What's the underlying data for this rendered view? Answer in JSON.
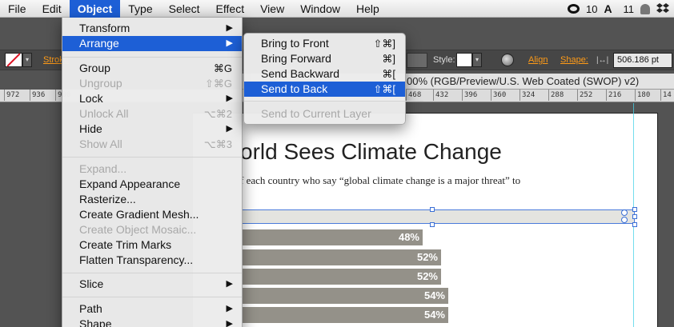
{
  "menubar": {
    "apple_hidden": "",
    "items": [
      "File",
      "Edit",
      "Object",
      "Type",
      "Select",
      "Effect",
      "View",
      "Window",
      "Help"
    ],
    "active": "Object",
    "tray": {
      "cc_count": "10",
      "adobe_count": "11"
    }
  },
  "control_bar": {
    "stroke_label": "Stroke",
    "style_label": "Style:",
    "align_label": "Align",
    "shape_label": "Shape:",
    "width_value": "506.186 pt"
  },
  "document_tab": {
    "title": "00% (RGB/Preview/U.S. Web Coated (SWOP) v2)"
  },
  "ruler": {
    "left_ticks": [
      "972",
      "936",
      "900"
    ],
    "right_ticks": [
      "468",
      "432",
      "396",
      "360",
      "324",
      "288",
      "252",
      "216",
      "180",
      "14"
    ]
  },
  "object_menu": {
    "items": [
      {
        "label": "Transform",
        "submenu": true,
        "disabled": false
      },
      {
        "label": "Arrange",
        "submenu": true,
        "disabled": false,
        "highlighted": true
      },
      {
        "label": "Group",
        "shortcut": "⌘G",
        "disabled": false
      },
      {
        "label": "Ungroup",
        "shortcut": "⇧⌘G",
        "disabled": true
      },
      {
        "label": "Lock",
        "submenu": true,
        "disabled": false
      },
      {
        "label": "Unlock All",
        "shortcut": "⌥⌘2",
        "disabled": true
      },
      {
        "label": "Hide",
        "submenu": true,
        "disabled": false
      },
      {
        "label": "Show All",
        "shortcut": "⌥⌘3",
        "disabled": true
      },
      {
        "label": "Expand...",
        "disabled": true
      },
      {
        "label": "Expand Appearance",
        "disabled": false
      },
      {
        "label": "Rasterize...",
        "disabled": false
      },
      {
        "label": "Create Gradient Mesh...",
        "disabled": false
      },
      {
        "label": "Create Object Mosaic...",
        "disabled": true
      },
      {
        "label": "Create Trim Marks",
        "disabled": false
      },
      {
        "label": "Flatten Transparency...",
        "disabled": false
      },
      {
        "label": "Slice",
        "submenu": true,
        "disabled": false
      },
      {
        "label": "Path",
        "submenu": true,
        "disabled": false
      },
      {
        "label": "Shape",
        "submenu": true,
        "disabled": false
      }
    ]
  },
  "arrange_menu": {
    "items": [
      {
        "label": "Bring to Front",
        "shortcut": "⇧⌘]",
        "disabled": false
      },
      {
        "label": "Bring Forward",
        "shortcut": "⌘]",
        "disabled": false
      },
      {
        "label": "Send Backward",
        "shortcut": "⌘[",
        "disabled": false
      },
      {
        "label": "Send to Back",
        "shortcut": "⇧⌘[",
        "disabled": false,
        "highlighted": true
      },
      {
        "label": "Send to Current Layer",
        "disabled": true
      }
    ]
  },
  "artwork": {
    "title": "orld Sees Climate Change",
    "subtitle": "f each country who say “global climate change is a major threat” to",
    "bars": [
      "48%",
      "52%",
      "52%",
      "54%",
      "54%"
    ]
  },
  "colors": {
    "menu_highlight": "#1d5fd6",
    "bar_fill": "#949189",
    "guide": "#46d1e8",
    "control_accent": "#ff9b17"
  }
}
